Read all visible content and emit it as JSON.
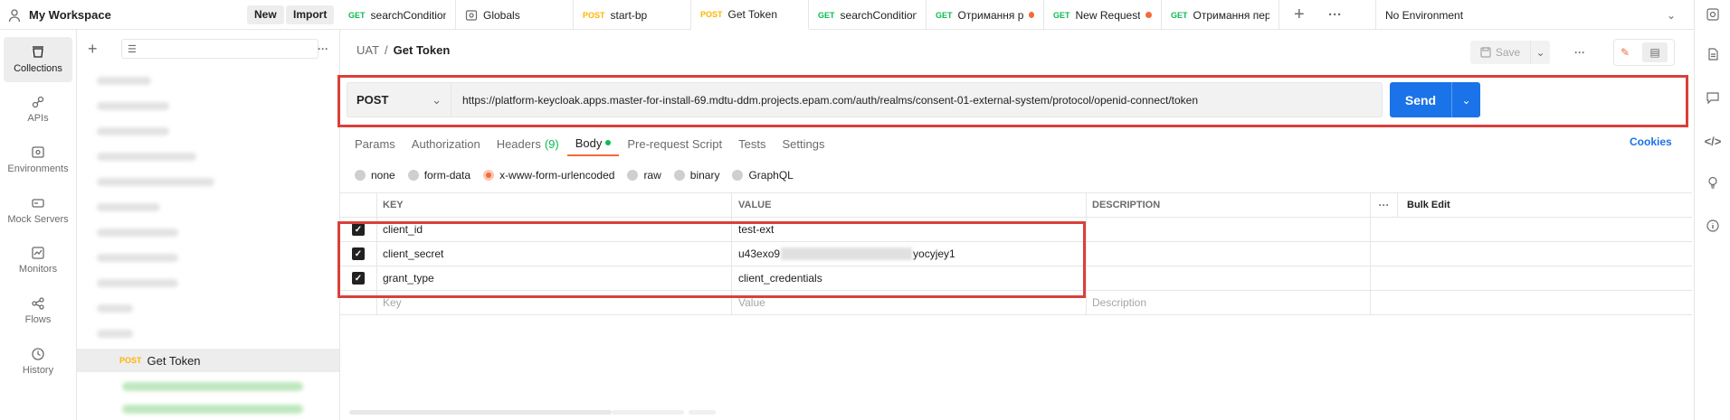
{
  "workspace": {
    "name": "My Workspace",
    "new_label": "New",
    "import_label": "Import"
  },
  "tabs": [
    {
      "method": "GET",
      "label": "searchConditionE",
      "dot": false,
      "active": false
    },
    {
      "method": "",
      "label": "Globals",
      "dot": false,
      "active": false
    },
    {
      "method": "POST",
      "label": "start-bp",
      "dot": false,
      "active": false
    },
    {
      "method": "POST",
      "label": "Get Token",
      "dot": false,
      "active": true
    },
    {
      "method": "GET",
      "label": "searchConditionE",
      "dot": false,
      "active": false
    },
    {
      "method": "GET",
      "label": "Отримання ре",
      "dot": true,
      "active": false
    },
    {
      "method": "GET",
      "label": "New Request",
      "dot": true,
      "active": false
    },
    {
      "method": "GET",
      "label": "Отримання періо",
      "dot": false,
      "active": false
    }
  ],
  "environment": {
    "selected": "No Environment"
  },
  "rail": [
    {
      "label": "Collections",
      "icon": "collections-icon",
      "active": true
    },
    {
      "label": "APIs",
      "icon": "apis-icon",
      "active": false
    },
    {
      "label": "Environments",
      "icon": "environments-icon",
      "active": false
    },
    {
      "label": "Mock Servers",
      "icon": "mock-servers-icon",
      "active": false
    },
    {
      "label": "Monitors",
      "icon": "monitors-icon",
      "active": false
    },
    {
      "label": "Flows",
      "icon": "flows-icon",
      "active": false
    },
    {
      "label": "History",
      "icon": "history-icon",
      "active": false
    }
  ],
  "sidebar": {
    "selected_item": {
      "method": "POST",
      "label": "Get Token"
    }
  },
  "request": {
    "breadcrumb": {
      "parent": "UAT",
      "separator": "/",
      "current": "Get Token"
    },
    "save_label": "Save",
    "method": "POST",
    "url": "https://platform-keycloak.apps.master-for-install-69.mdtu-ddm.projects.epam.com/auth/realms/consent-01-external-system/protocol/openid-connect/token",
    "send_label": "Send",
    "tabs": [
      {
        "label": "Params",
        "count": "",
        "active": false
      },
      {
        "label": "Authorization",
        "count": "",
        "active": false
      },
      {
        "label": "Headers",
        "count": "(9)",
        "active": false
      },
      {
        "label": "Body",
        "count": "",
        "active": true
      },
      {
        "label": "Pre-request Script",
        "count": "",
        "active": false
      },
      {
        "label": "Tests",
        "count": "",
        "active": false
      },
      {
        "label": "Settings",
        "count": "",
        "active": false
      }
    ],
    "cookies_label": "Cookies",
    "body_types": [
      {
        "label": "none",
        "selected": false
      },
      {
        "label": "form-data",
        "selected": false
      },
      {
        "label": "x-www-form-urlencoded",
        "selected": true
      },
      {
        "label": "raw",
        "selected": false
      },
      {
        "label": "binary",
        "selected": false
      },
      {
        "label": "GraphQL",
        "selected": false
      }
    ],
    "table": {
      "headers": {
        "key": "KEY",
        "value": "VALUE",
        "description": "DESCRIPTION",
        "bulk_edit": "Bulk Edit"
      },
      "rows": [
        {
          "checked": true,
          "key": "client_id",
          "value": "test-ext",
          "value_suffix": "",
          "masked": false,
          "description": ""
        },
        {
          "checked": true,
          "key": "client_secret",
          "value": "u43exo9",
          "value_suffix": "yocyjey1",
          "masked": true,
          "description": ""
        },
        {
          "checked": true,
          "key": "grant_type",
          "value": "client_credentials",
          "value_suffix": "",
          "masked": false,
          "description": ""
        }
      ],
      "placeholders": {
        "key": "Key",
        "value": "Value",
        "description": "Description"
      }
    }
  },
  "colors": {
    "accent": "#f26b3a",
    "send": "#1a73e8",
    "get": "#0cbb52",
    "post": "#ffb400",
    "highlight_frame": "#d9403a"
  }
}
